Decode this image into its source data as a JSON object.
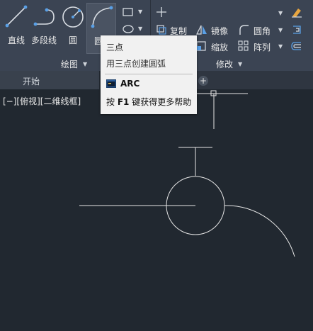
{
  "ribbon": {
    "draw_tools": {
      "line": "直线",
      "polyline": "多段线",
      "circle": "圆",
      "arc": "圆弧"
    },
    "modify_tools": {
      "copy": "复制",
      "mirror": "镜像",
      "fillet": "圆角",
      "scale": "缩放",
      "array": "阵列"
    },
    "panels": {
      "draw": "绘图",
      "modify": "修改"
    }
  },
  "tabs": {
    "start": "开始",
    "add": "+"
  },
  "viewport": {
    "label": "[−][俯视][二维线框]"
  },
  "tooltip": {
    "title": "三点",
    "description": "用三点创建圆弧",
    "command": "ARC",
    "help_prefix": "按",
    "help_key": "F1",
    "help_suffix": "键获得更多帮助"
  },
  "colors": {
    "ribbon_bg": "#3b4453",
    "canvas_bg": "#212830",
    "tooltip_bg": "#f1f1f1",
    "accent": "#5aa0e6"
  }
}
